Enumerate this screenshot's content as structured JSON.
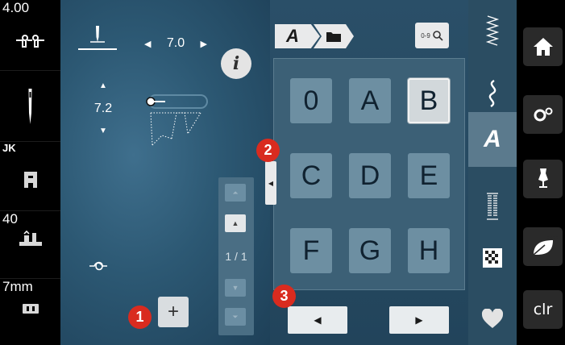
{
  "left_status": {
    "thread_tension": "4.00",
    "presser_foot_pressure": "JK",
    "stitch_plate_value": "40",
    "stitch_plate_size": "7mm"
  },
  "stitch_params": {
    "width_value": "7.0",
    "length_value": "7.2"
  },
  "info_button_label": "i",
  "picker": {
    "mode_letter": "A",
    "search_label": "0-9",
    "keys": [
      "0",
      "A",
      "B",
      "C",
      "D",
      "E",
      "F",
      "G",
      "H"
    ],
    "selected_key": "B"
  },
  "scroll": {
    "page_indicator": "1 / 1"
  },
  "badges": {
    "one": "1",
    "two": "2",
    "three": "3"
  },
  "add_button_label": "+",
  "right_bar": {
    "eco_label": "eco",
    "clr_label": "clr"
  },
  "category_tabs": [
    "practical-stitches",
    "decorative-stitches",
    "alphabets",
    "buttonholes",
    "quilt-stitches",
    "personal-program"
  ],
  "active_category": "alphabets",
  "colors": {
    "accent_red": "#d92b1f",
    "panel_blue": "#2a4f68",
    "key_blue": "#6d8fa2"
  }
}
